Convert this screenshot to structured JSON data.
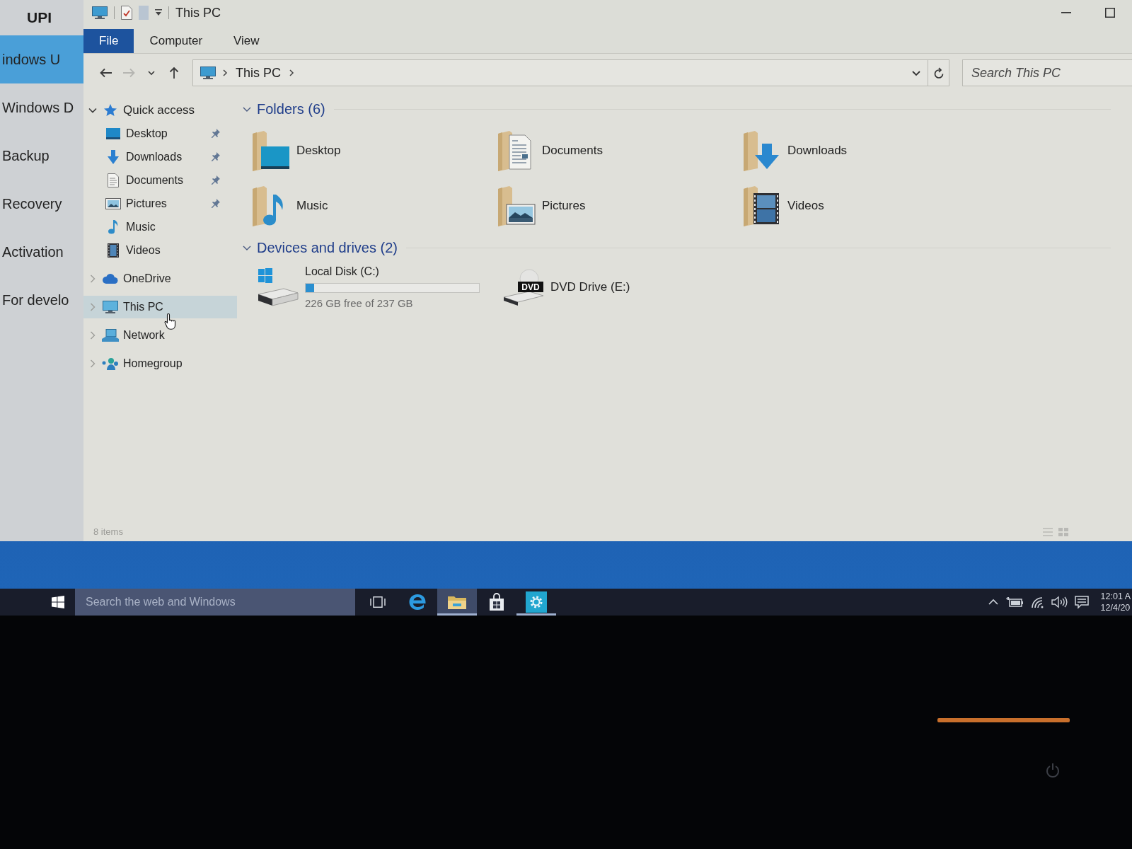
{
  "background_window": {
    "title": "UPI",
    "items": [
      {
        "label": "indows U",
        "selected": true
      },
      {
        "label": "Windows D",
        "selected": false
      },
      {
        "label": "Backup",
        "selected": false
      },
      {
        "label": "Recovery",
        "selected": false
      },
      {
        "label": "Activation",
        "selected": false
      },
      {
        "label": "For develo",
        "selected": false
      }
    ]
  },
  "window": {
    "title": "This PC"
  },
  "ribbon_tabs": [
    {
      "label": "File",
      "selected": true
    },
    {
      "label": "Computer",
      "selected": false
    },
    {
      "label": "View",
      "selected": false
    }
  ],
  "nav_buttons": [
    {
      "kind": "back",
      "disabled": false
    },
    {
      "kind": "forward",
      "disabled": true
    },
    {
      "kind": "recent",
      "disabled": false
    },
    {
      "kind": "up",
      "disabled": false
    }
  ],
  "address_bar": {
    "path": [
      "This PC"
    ]
  },
  "search": {
    "placeholder": "Search This PC"
  },
  "navigation_pane": {
    "items": [
      {
        "label": "Quick access",
        "kind": "star",
        "expanded": true,
        "selected": false,
        "children": [
          {
            "label": "Desktop",
            "kind": "desktop",
            "pinned": true,
            "selected": false
          },
          {
            "label": "Downloads",
            "kind": "downloads",
            "pinned": true,
            "selected": false
          },
          {
            "label": "Documents",
            "kind": "documents",
            "pinned": true,
            "selected": false
          },
          {
            "label": "Pictures",
            "kind": "pictures",
            "pinned": true,
            "selected": false
          },
          {
            "label": "Music",
            "kind": "music",
            "pinned": false,
            "selected": false
          },
          {
            "label": "Videos",
            "kind": "videos",
            "pinned": false,
            "selected": false
          }
        ]
      },
      {
        "label": "OneDrive",
        "kind": "onedrive",
        "expanded": false,
        "selected": false
      },
      {
        "label": "This PC",
        "kind": "pc",
        "expanded": false,
        "selected": true
      },
      {
        "label": "Network",
        "kind": "network",
        "expanded": false,
        "selected": false
      },
      {
        "label": "Homegroup",
        "kind": "homegroup",
        "expanded": false,
        "selected": false
      }
    ]
  },
  "groups": [
    {
      "title": "Folders (6)",
      "expanded": true,
      "items": [
        {
          "label": "Desktop",
          "kind": "desktop"
        },
        {
          "label": "Documents",
          "kind": "documents"
        },
        {
          "label": "Downloads",
          "kind": "downloads"
        },
        {
          "label": "Music",
          "kind": "music"
        },
        {
          "label": "Pictures",
          "kind": "pictures"
        },
        {
          "label": "Videos",
          "kind": "videos"
        }
      ]
    },
    {
      "title": "Devices and drives (2)",
      "expanded": true,
      "items": [
        {
          "label": "Local Disk (C:)",
          "kind": "disk",
          "level": 0.05,
          "free_space": "226 GB free of 237 GB"
        },
        {
          "label": "DVD Drive (E:)",
          "kind": "dvd",
          "badge": "DVD"
        }
      ]
    }
  ],
  "status_bar": {
    "text": "8 items"
  },
  "taskbar": {
    "search": {
      "placeholder": "Search the web and Windows"
    },
    "apps": [
      {
        "kind": "task-view",
        "selected": false,
        "open": false
      },
      {
        "kind": "edge",
        "selected": false,
        "open": false
      },
      {
        "kind": "explorer",
        "selected": true,
        "open": true
      },
      {
        "kind": "store",
        "selected": false,
        "open": false
      },
      {
        "kind": "settings",
        "selected": false,
        "open": true
      }
    ],
    "clock": {
      "time": "12:01 A",
      "date": "12/4/20"
    }
  }
}
